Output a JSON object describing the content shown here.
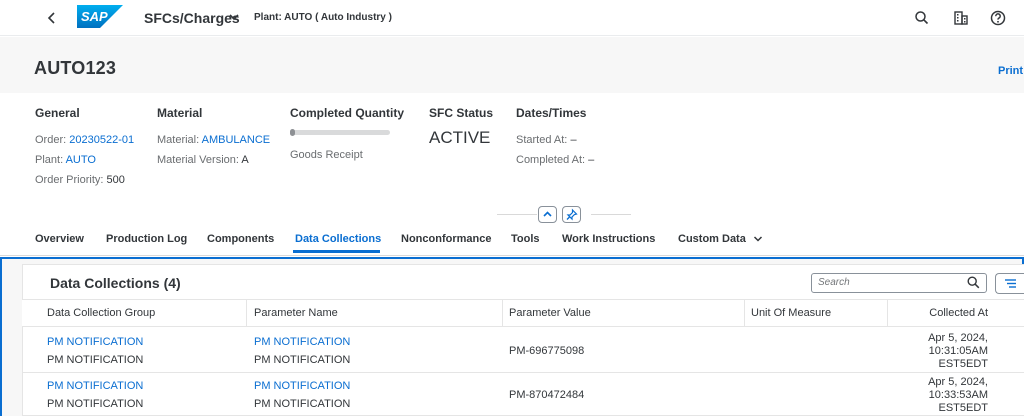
{
  "shell": {
    "logo_text": "SAP",
    "app_title": "SFCs/Charges",
    "plant_label": "Plant: AUTO ( Auto Industry )"
  },
  "header": {
    "title": "AUTO123",
    "print_label": "Print"
  },
  "facets": {
    "general": {
      "heading": "General",
      "order_label": "Order:",
      "order_value": "20230522-01",
      "plant_label": "Plant:",
      "plant_value": "AUTO",
      "priority_label": "Order Priority:",
      "priority_value": "500"
    },
    "material": {
      "heading": "Material",
      "material_label": "Material:",
      "material_value": "AMBULANCE",
      "version_label": "Material Version:",
      "version_value": "A"
    },
    "completed_quantity": {
      "heading": "Completed Quantity",
      "progress_fraction": 0,
      "caption": "Goods Receipt"
    },
    "sfc_status": {
      "heading": "SFC Status",
      "value": "ACTIVE"
    },
    "dates": {
      "heading": "Dates/Times",
      "started_label": "Started At:",
      "started_value": "–",
      "completed_label": "Completed At:",
      "completed_value": "–"
    }
  },
  "tabs": [
    {
      "label": "Overview"
    },
    {
      "label": "Production Log"
    },
    {
      "label": "Components"
    },
    {
      "label": "Data Collections"
    },
    {
      "label": "Nonconformance"
    },
    {
      "label": "Tools"
    },
    {
      "label": "Work Instructions"
    },
    {
      "label": "Custom Data"
    }
  ],
  "selected_tab": "Data Collections",
  "data_collections": {
    "title": "Data Collections (4)",
    "search_placeholder": "Search",
    "columns": [
      "Data Collection Group",
      "Parameter Name",
      "Parameter Value",
      "Unit Of Measure",
      "Collected At"
    ],
    "rows": [
      {
        "group_link": "PM NOTIFICATION",
        "group_text": "PM NOTIFICATION",
        "param_link": "PM NOTIFICATION",
        "param_text": "PM NOTIFICATION",
        "value": "PM-696775098",
        "uom": "",
        "collected_date": "Apr 5, 2024,",
        "collected_time": "10:31:05AM",
        "collected_tz": "EST5EDT"
      },
      {
        "group_link": "PM NOTIFICATION",
        "group_text": "PM NOTIFICATION",
        "param_link": "PM NOTIFICATION",
        "param_text": "PM NOTIFICATION",
        "value": "PM-870472484",
        "uom": "",
        "collected_date": "Apr 5, 2024,",
        "collected_time": "10:33:53AM",
        "collected_tz": "EST5EDT"
      }
    ]
  },
  "colors": {
    "brand_blue": "#0a6ed1",
    "text": "#32363a",
    "label": "#6a6d70"
  }
}
